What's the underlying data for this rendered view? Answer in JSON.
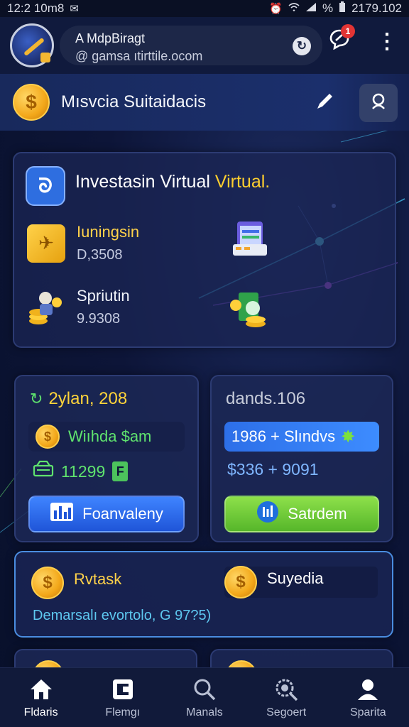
{
  "status_bar": {
    "time": "12:2 10m8",
    "right_text": "2179.102",
    "battery_text": "%"
  },
  "browser": {
    "page_title": "A MdpBiragt",
    "url": "@ gamsa ıtirttile.ocom",
    "notification_count": "1"
  },
  "header": {
    "title": "Mısvcia Suitaidacis"
  },
  "invest_card": {
    "title_main": "Investasin Virtual",
    "title_accent": "Virtual.",
    "rows": [
      {
        "label": "Iuningsin",
        "value": "D,3508"
      },
      {
        "label": "Spriutin",
        "value": "9.9308"
      }
    ]
  },
  "left_stat": {
    "heading": "2ylan, 208",
    "pill_label": "Wiıhda $am",
    "value": "11299",
    "button_label": "Foanvaleny"
  },
  "right_stat": {
    "heading": "dands.106",
    "pill_label": "1986 + Slındvs",
    "value": "$336 + 9091",
    "button_label": "Satrdem"
  },
  "rewards": {
    "left_label": "Rvtask",
    "right_label": "Suyedia",
    "footer": "Demarsalı evortolo, G 97?5)"
  },
  "nav": [
    {
      "label": "Fldaris",
      "icon": "home-icon"
    },
    {
      "label": "Flemgı",
      "icon": "wallet-icon"
    },
    {
      "label": "Manals",
      "icon": "search-icon"
    },
    {
      "label": "Segoert",
      "icon": "gear-search-icon"
    },
    {
      "label": "Sparita",
      "icon": "profile-icon"
    }
  ],
  "colors": {
    "accent_gold": "#ffd24a",
    "accent_blue": "#2d6fe8",
    "accent_green": "#5fe36e",
    "background": "#0d1538"
  }
}
